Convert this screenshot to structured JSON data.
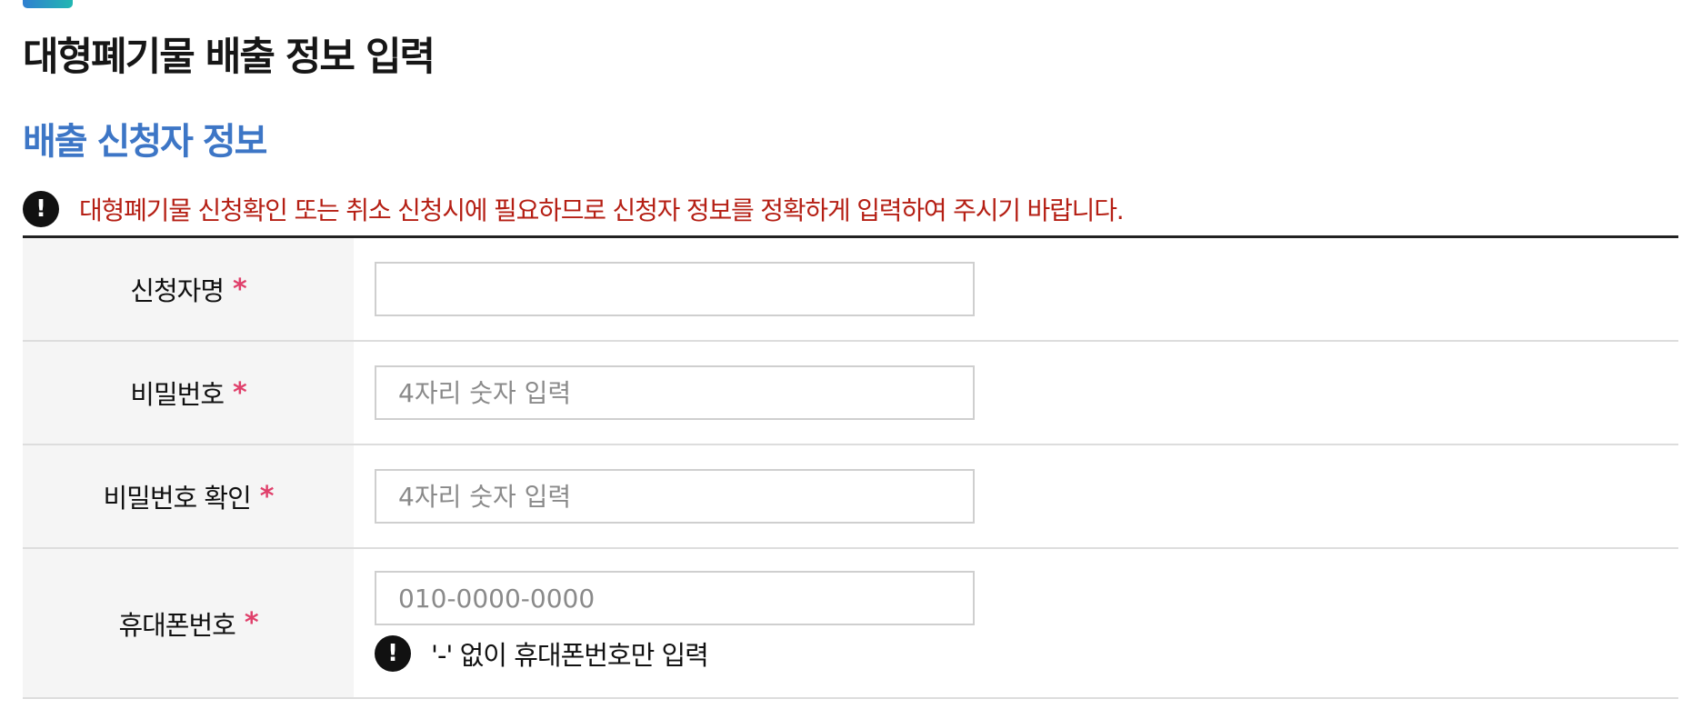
{
  "page": {
    "title": "대형폐기물 배출 정보 입력",
    "section_title": "배출 신청자 정보",
    "notice_icon": "!",
    "notice_text": "대형폐기물 신청확인 또는 취소 신청시에 필요하므로 신청자 정보를 정확하게 입력하여 주시기 바랍니다."
  },
  "form": {
    "required_mark": "*",
    "fields": [
      {
        "label": "신청자명",
        "value": "",
        "placeholder": ""
      },
      {
        "label": "비밀번호",
        "value": "",
        "placeholder": "4자리 숫자 입력"
      },
      {
        "label": "비밀번호 확인",
        "value": "",
        "placeholder": "4자리 숫자 입력"
      },
      {
        "label": "휴대폰번호",
        "value": "",
        "placeholder": "010-0000-0000",
        "hint_icon": "!",
        "hint": "'-' 없이 휴대폰번호만 입력"
      }
    ]
  },
  "colors": {
    "accent_blue": "#3d76c6",
    "notice_red": "#b51f14",
    "required_pink": "#e0406b",
    "label_bg": "#f5f5f5"
  },
  "icons": {
    "notice": "exclamation-circle-icon",
    "hint": "exclamation-circle-icon"
  }
}
